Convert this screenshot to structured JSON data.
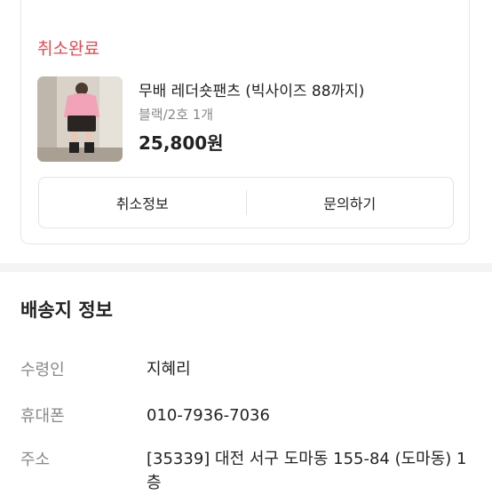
{
  "order": {
    "status": "취소완료",
    "product_name": "무배 레더숏팬츠 (빅사이즈 88까지)",
    "product_option": "블랙/2호 1개",
    "price": "25,800원",
    "cancel_info_label": "취소정보",
    "inquiry_label": "문의하기"
  },
  "shipping": {
    "title": "배송지 정보",
    "recipient_label": "수령인",
    "recipient_value": "지혜리",
    "phone_label": "휴대폰",
    "phone_value": "010-7936-7036",
    "address_label": "주소",
    "address_value": "[35339] 대전 서구 도마동 155-84 (도마동) 1층"
  },
  "colors": {
    "status_red": "#e8494f",
    "section_bg": "#f4f4f5"
  }
}
